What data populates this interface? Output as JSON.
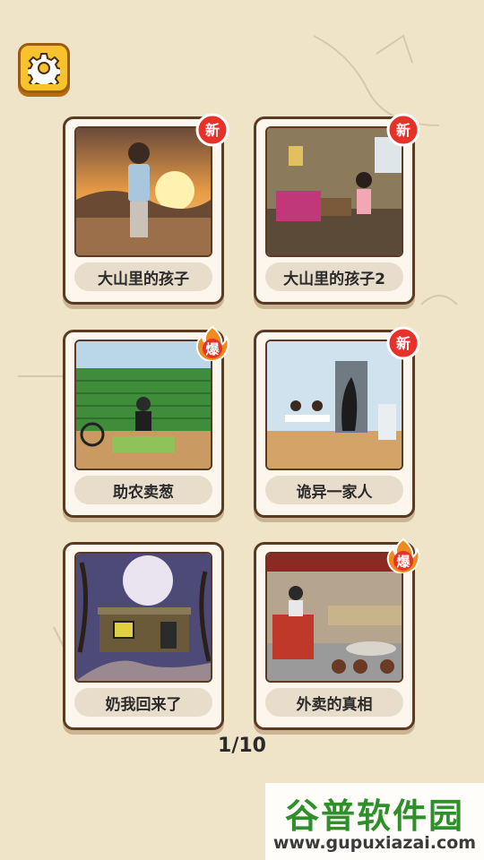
{
  "settings": {
    "icon": "gear-icon",
    "color": "#f7c22c"
  },
  "levels": [
    {
      "title": "大山里的孩子",
      "badge": "新",
      "badge_type": "new"
    },
    {
      "title": "大山里的孩子2",
      "badge": "新",
      "badge_type": "new"
    },
    {
      "title": "助农卖葱",
      "badge": "爆",
      "badge_type": "hot"
    },
    {
      "title": "诡异一家人",
      "badge": "新",
      "badge_type": "new"
    },
    {
      "title": "奶我回来了",
      "badge": "",
      "badge_type": "none"
    },
    {
      "title": "外卖的真相",
      "badge": "爆",
      "badge_type": "hot"
    }
  ],
  "pager": {
    "text": "1/10"
  },
  "watermark": {
    "title": "谷普软件园",
    "url": "www.gupuxiazai.com"
  }
}
